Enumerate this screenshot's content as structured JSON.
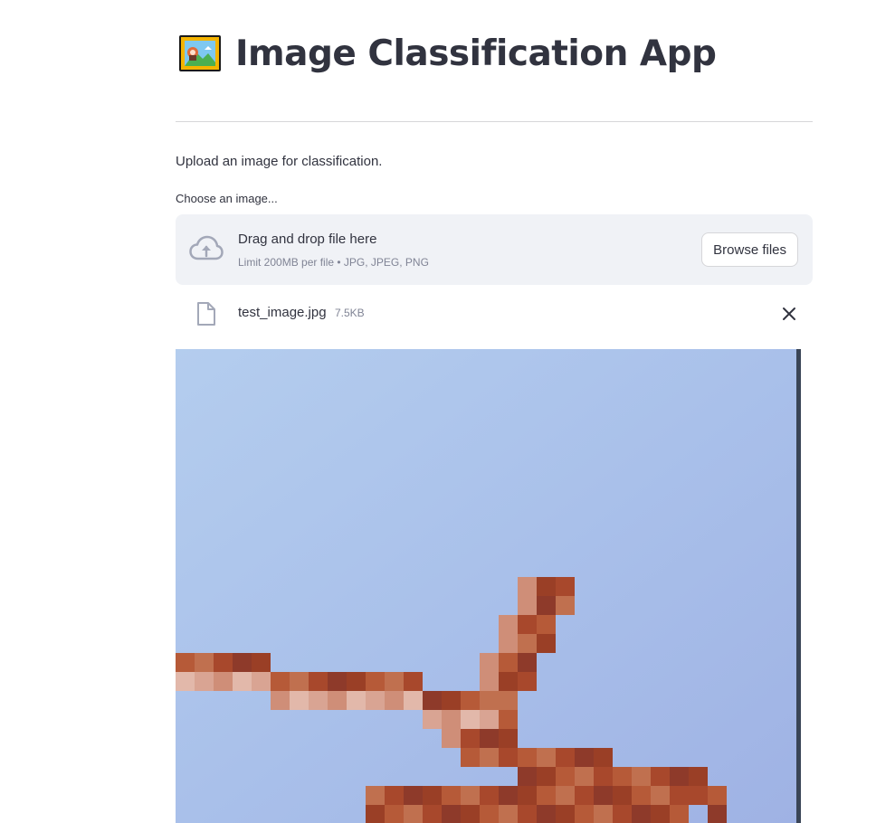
{
  "app": {
    "title": "Image Classification App",
    "title_icon": "framed-picture-icon"
  },
  "intro_text": "Upload an image for classification.",
  "uploader": {
    "label": "Choose an image...",
    "drop_title": "Drag and drop file here",
    "drop_subtitle": "Limit 200MB per file • JPG, JPEG, PNG",
    "browse_label": "Browse files",
    "upload_icon": "cloud-upload-icon"
  },
  "uploaded_file": {
    "name": "test_image.jpg",
    "size": "7.5KB",
    "file_icon": "file-icon",
    "remove_icon": "close-icon"
  },
  "preview": {
    "image_icon": "uploaded-image-preview"
  },
  "colors": {
    "text": "#31333f",
    "muted": "#808495",
    "dropzone_bg": "#f0f2f6",
    "icon": "#a3a8b8",
    "sky": "#a9c2e8",
    "plane": "#b25a38"
  }
}
